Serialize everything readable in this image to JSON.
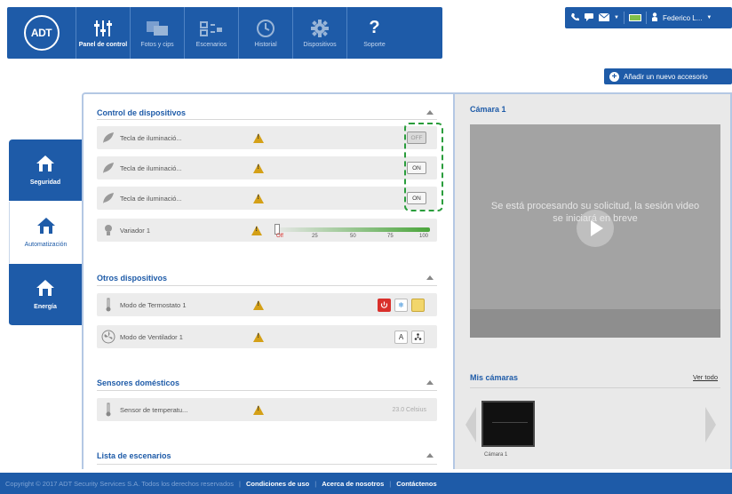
{
  "nav": {
    "logo": "ADT",
    "items": [
      {
        "label": "Panel de control",
        "icon": "sliders-icon"
      },
      {
        "label": "Fotos y cips",
        "icon": "photos-icon"
      },
      {
        "label": "Escenarios",
        "icon": "scenarios-icon"
      },
      {
        "label": "Historial",
        "icon": "clock-icon"
      },
      {
        "label": "Dispositivos",
        "icon": "gear-icon"
      },
      {
        "label": "Soporte",
        "icon": "question-icon"
      }
    ]
  },
  "statusbar": {
    "user": "Federico L...",
    "battery_color": "#7fc04a"
  },
  "add_accessory": "Añadir un nuevo accesorio",
  "side_tabs": [
    {
      "label": "Seguridad"
    },
    {
      "label": "Automatización"
    },
    {
      "label": "Energía"
    }
  ],
  "device_control": {
    "title": "Control de dispositivos",
    "rows": [
      {
        "label": "Tecla de iluminació...",
        "state": "OFF"
      },
      {
        "label": "Tecla de iluminació...",
        "state": "ON"
      },
      {
        "label": "Tecla de iluminació...",
        "state": "ON"
      }
    ],
    "dimmer": {
      "label": "Variador 1",
      "value_percent": 0,
      "ticks": [
        "Off",
        "25",
        "50",
        "75",
        "100"
      ]
    }
  },
  "other_devices": {
    "title": "Otros dispositivos",
    "rows": [
      {
        "label": "Modo de Termostato 1"
      },
      {
        "label": "Modo de Ventilador 1"
      }
    ],
    "fan_auto": "A"
  },
  "sensors": {
    "title": "Sensores domésticos",
    "rows": [
      {
        "label": "Sensor de temperatu...",
        "value": "23.0 Celsius"
      }
    ]
  },
  "scenes": {
    "title": "Lista de escenarios"
  },
  "camera": {
    "title": "Cámara 1",
    "message": "Se está procesando su solicitud, la sesión video se iniciará en breve",
    "my_cameras": "Mis cámaras",
    "view_all": "Ver todo",
    "thumb_label": "Cámara 1"
  },
  "footer": {
    "copyright": "Copyright © 2017 ADT Security Services S.A. Todos los derechos reservados",
    "links": [
      "Condiciones de uso",
      "Acerca de nosotros",
      "Contáctenos"
    ]
  },
  "colors": {
    "brand": "#1e5ba8",
    "warning": "#d4a017",
    "highlight": "#2a9d3c"
  }
}
